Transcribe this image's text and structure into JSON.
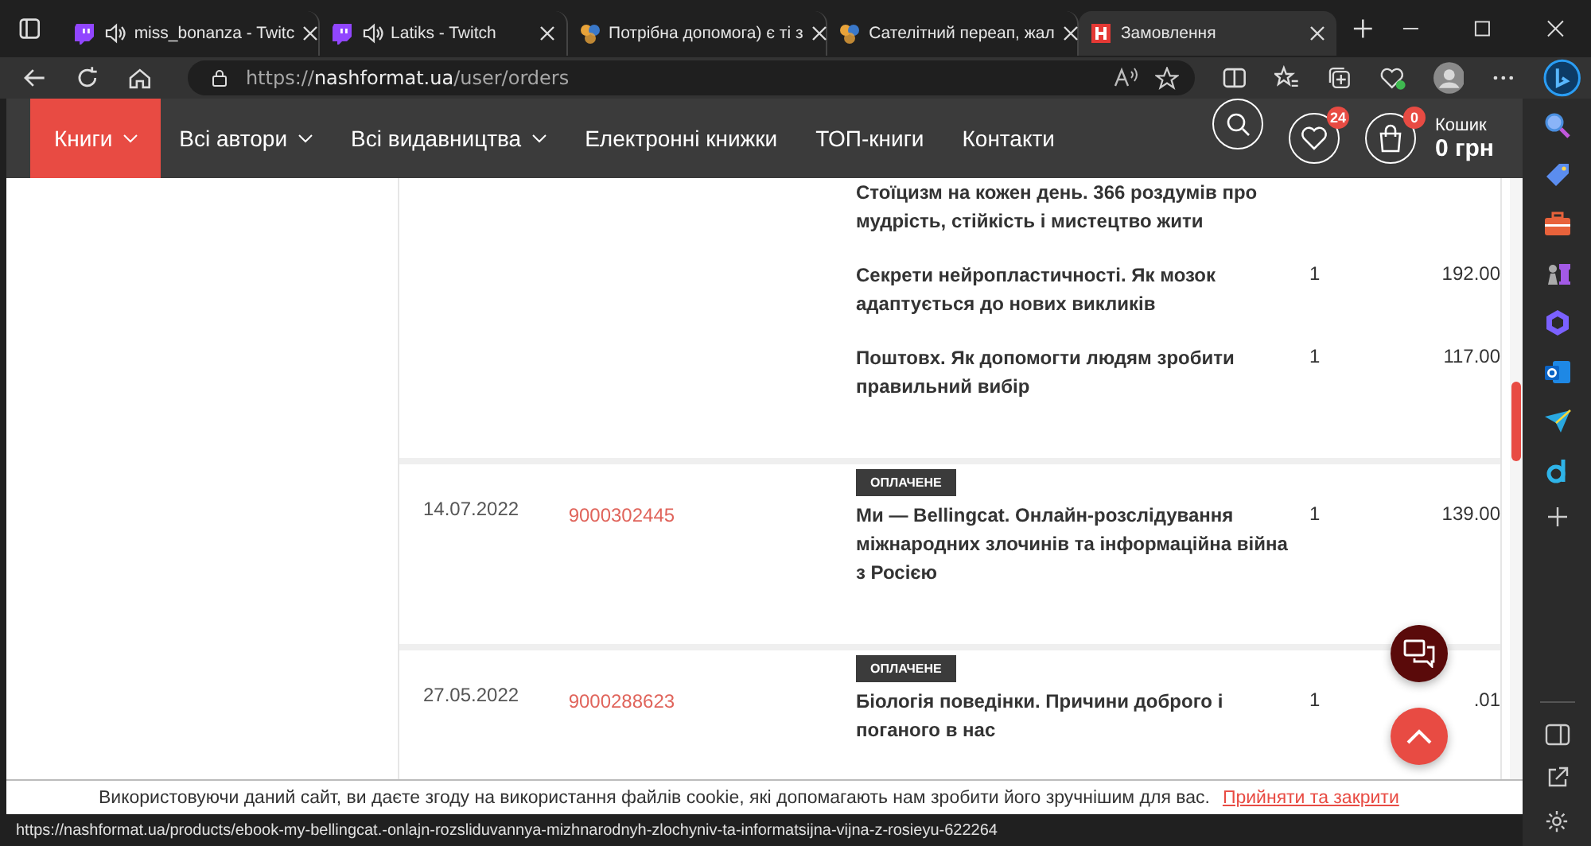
{
  "tabs": [
    {
      "title": "miss_bonanza - Twitc",
      "kind": "twitch",
      "audio": true,
      "selected": false
    },
    {
      "title": "Latiks - Twitch",
      "kind": "twitch",
      "audio": true,
      "selected": false
    },
    {
      "title": "Потрібна допомога) є ті з",
      "kind": "forum",
      "audio": false,
      "selected": false
    },
    {
      "title": "Сателітний переап, жал",
      "kind": "forum",
      "audio": false,
      "selected": false
    },
    {
      "title": "Замовлення",
      "kind": "shop",
      "audio": false,
      "selected": true
    }
  ],
  "address": {
    "scheme": "https://",
    "host": "nashformat.ua",
    "path": "/user/orders"
  },
  "nav": {
    "items": [
      {
        "label": "Книги",
        "dropdown": true,
        "selected": true
      },
      {
        "label": "Всі автори",
        "dropdown": true,
        "selected": false
      },
      {
        "label": "Всі видавництва",
        "dropdown": true,
        "selected": false
      },
      {
        "label": "Електронні книжки",
        "dropdown": false,
        "selected": false
      },
      {
        "label": "ТОП-книги",
        "dropdown": false,
        "selected": false
      },
      {
        "label": "Контакти",
        "dropdown": false,
        "selected": false
      }
    ],
    "wishlist_count": "24",
    "cart_count": "0",
    "cart_label": "Кошик",
    "cart_total": "0 грн"
  },
  "orders": [
    {
      "items": [
        {
          "title": "Стоїцизм на кожен день. 366 роздумів про мудрість, стійкість і мистецтво жити"
        },
        {
          "title": "Секрети нейропластичності. Як мозок адаптується до нових викликів",
          "qty": "1",
          "price": "192.00"
        },
        {
          "title": "Поштовх. Як допомогти людям зробити правильний вибір",
          "qty": "1",
          "price": "117.00"
        }
      ]
    },
    {
      "date": "14.07.2022",
      "number": "9000302445",
      "status": "ОПЛАЧЕНЕ",
      "items": [
        {
          "title": "Ми — Bellingcat. Онлайн-розслідування міжнародних злочинів та інформаційна війна з Росією",
          "qty": "1",
          "price": "139.00"
        }
      ]
    },
    {
      "date": "27.05.2022",
      "number": "9000288623",
      "status": "ОПЛАЧЕНЕ",
      "items": [
        {
          "title": "Біологія поведінки. Причини доброго і поганого в нас",
          "qty": "1",
          "price": ".01"
        }
      ]
    }
  ],
  "cookie": {
    "text": "Використовуючи даний сайт, ви даєте згоду на використання файлів cookie, які допомагають нам зробити його зручнішим для вас.",
    "link": "Прийняти та закрити"
  },
  "status_url": "https://nashformat.ua/products/ebook-my-bellingcat.-onlajn-rozsliduvannya-mizhnarodnyh-zlochyniv-ta-informatsijna-vijna-z-rosieyu-622264"
}
